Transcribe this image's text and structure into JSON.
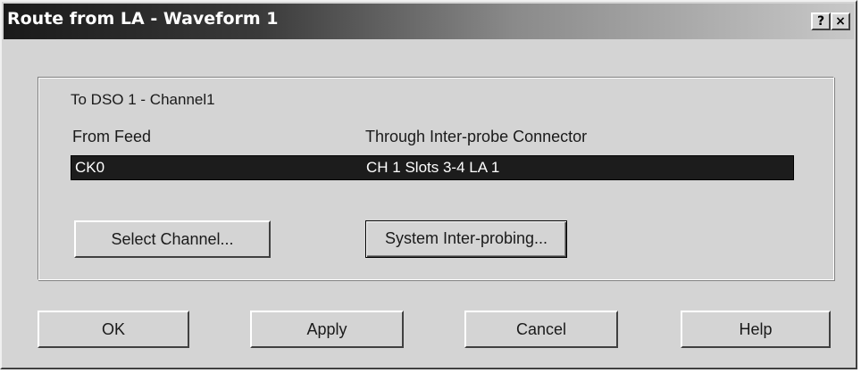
{
  "window": {
    "title": "Route from LA - Waveform 1",
    "help_glyph": "?",
    "close_glyph": "×"
  },
  "group": {
    "to_label": "To DSO 1 - Channel1",
    "columns": {
      "from": "From Feed",
      "through": "Through Inter-probe Connector"
    },
    "row": {
      "from": "CK0",
      "through": "CH 1 Slots 3-4 LA 1"
    },
    "buttons": {
      "select_channel": "Select Channel...",
      "system_interprobing": "System Inter-probing..."
    }
  },
  "footer": {
    "ok": "OK",
    "apply": "Apply",
    "cancel": "Cancel",
    "help": "Help"
  }
}
